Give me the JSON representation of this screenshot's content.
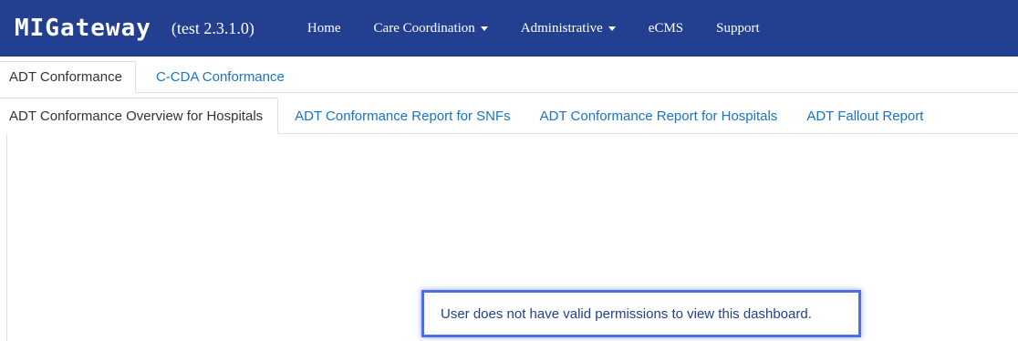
{
  "navbar": {
    "brand": "MIGateway",
    "version": "(test 2.3.1.0)",
    "items": [
      {
        "label": "Home",
        "dropdown": false
      },
      {
        "label": "Care Coordination",
        "dropdown": true
      },
      {
        "label": "Administrative",
        "dropdown": true
      },
      {
        "label": "eCMS",
        "dropdown": false
      },
      {
        "label": "Support",
        "dropdown": false
      }
    ]
  },
  "tabs_primary": [
    {
      "label": "ADT Conformance",
      "active": true
    },
    {
      "label": "C-CDA Conformance",
      "active": false
    }
  ],
  "tabs_secondary": [
    {
      "label": "ADT Conformance Overview for Hospitals",
      "active": true
    },
    {
      "label": "ADT Conformance Report for SNFs",
      "active": false
    },
    {
      "label": "ADT Conformance Report for Hospitals",
      "active": false
    },
    {
      "label": "ADT Fallout Report",
      "active": false
    }
  ],
  "message": "User does not have valid permissions to view this dashboard.",
  "colors": {
    "navbar_bg": "#22408f",
    "link": "#1a73c7",
    "highlight_border": "#4d6ee6"
  }
}
